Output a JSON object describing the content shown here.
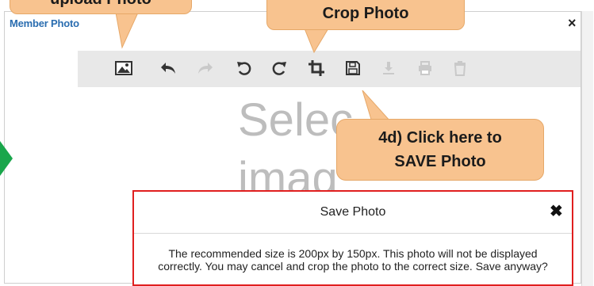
{
  "window": {
    "title": "Member Photo",
    "close_glyph": "×"
  },
  "toolbar": {
    "buttons": [
      {
        "name": "upload-image-icon",
        "state": "enabled"
      },
      {
        "name": "undo-icon",
        "state": "enabled"
      },
      {
        "name": "redo-icon",
        "state": "disabled"
      },
      {
        "name": "rotate-left-icon",
        "state": "enabled"
      },
      {
        "name": "rotate-right-icon",
        "state": "enabled"
      },
      {
        "name": "crop-icon",
        "state": "enabled"
      },
      {
        "name": "save-icon",
        "state": "enabled"
      },
      {
        "name": "download-icon",
        "state": "disabled"
      },
      {
        "name": "print-icon",
        "state": "disabled"
      },
      {
        "name": "delete-icon",
        "state": "disabled"
      }
    ]
  },
  "dropzone": {
    "line1": "Selec",
    "line2": "imag"
  },
  "callouts": {
    "upload": "upload Photo",
    "crop": "Crop Photo",
    "save_line1": "4d) Click here to",
    "save_line2": "SAVE Photo"
  },
  "dialog": {
    "title": "Save Photo",
    "close_glyph": "✖",
    "message": "The recommended size is 200px by 150px. This photo will not be displayed correctly. You may cancel and crop the photo to the correct size. Save anyway?"
  },
  "colors": {
    "accent_title": "#2a6db0",
    "callout_fill": "#f8c38f",
    "dialog_border": "#e01f1f",
    "arrow_green": "#19a64b"
  }
}
